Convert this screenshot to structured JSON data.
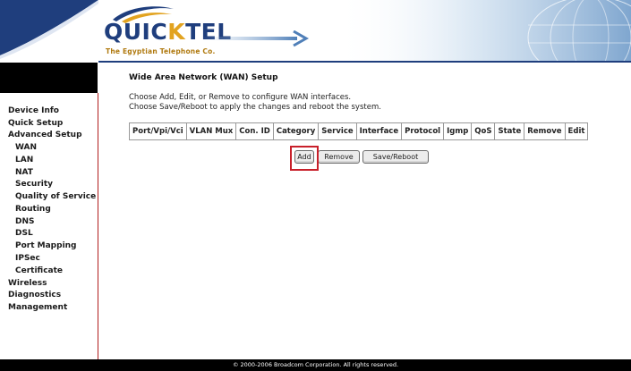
{
  "brand": {
    "logo_text_a": "QUIC",
    "logo_text_b": "K",
    "logo_text_c": "TEL",
    "tagline": "The Egyptian Telephone Co."
  },
  "sidebar": {
    "items": [
      {
        "label": "Device Info"
      },
      {
        "label": "Quick Setup"
      },
      {
        "label": "Advanced Setup"
      },
      {
        "label": "WAN"
      },
      {
        "label": "LAN"
      },
      {
        "label": "NAT"
      },
      {
        "label": "Security"
      },
      {
        "label": "Quality of Service"
      },
      {
        "label": "Routing"
      },
      {
        "label": "DNS"
      },
      {
        "label": "DSL"
      },
      {
        "label": "Port Mapping"
      },
      {
        "label": "IPSec"
      },
      {
        "label": "Certificate"
      },
      {
        "label": "Wireless"
      },
      {
        "label": "Diagnostics"
      },
      {
        "label": "Management"
      }
    ]
  },
  "main": {
    "title": "Wide Area Network (WAN) Setup",
    "desc_line1": "Choose Add, Edit, or Remove to configure WAN interfaces.",
    "desc_line2": "Choose Save/Reboot to apply the changes and reboot the system.",
    "table_headers": [
      "Port/Vpi/Vci",
      "VLAN Mux",
      "Con. ID",
      "Category",
      "Service",
      "Interface",
      "Protocol",
      "Igmp",
      "QoS",
      "State",
      "Remove",
      "Edit"
    ],
    "buttons": {
      "add": "Add",
      "remove": "Remove",
      "save_reboot": "Save/Reboot"
    }
  },
  "footer": {
    "copyright": "© 2000-2006 Broadcom Corporation. All rights reserved."
  },
  "colors": {
    "navy": "#1f3e7d",
    "gold": "#e2a320",
    "highlight": "#c8202a"
  }
}
